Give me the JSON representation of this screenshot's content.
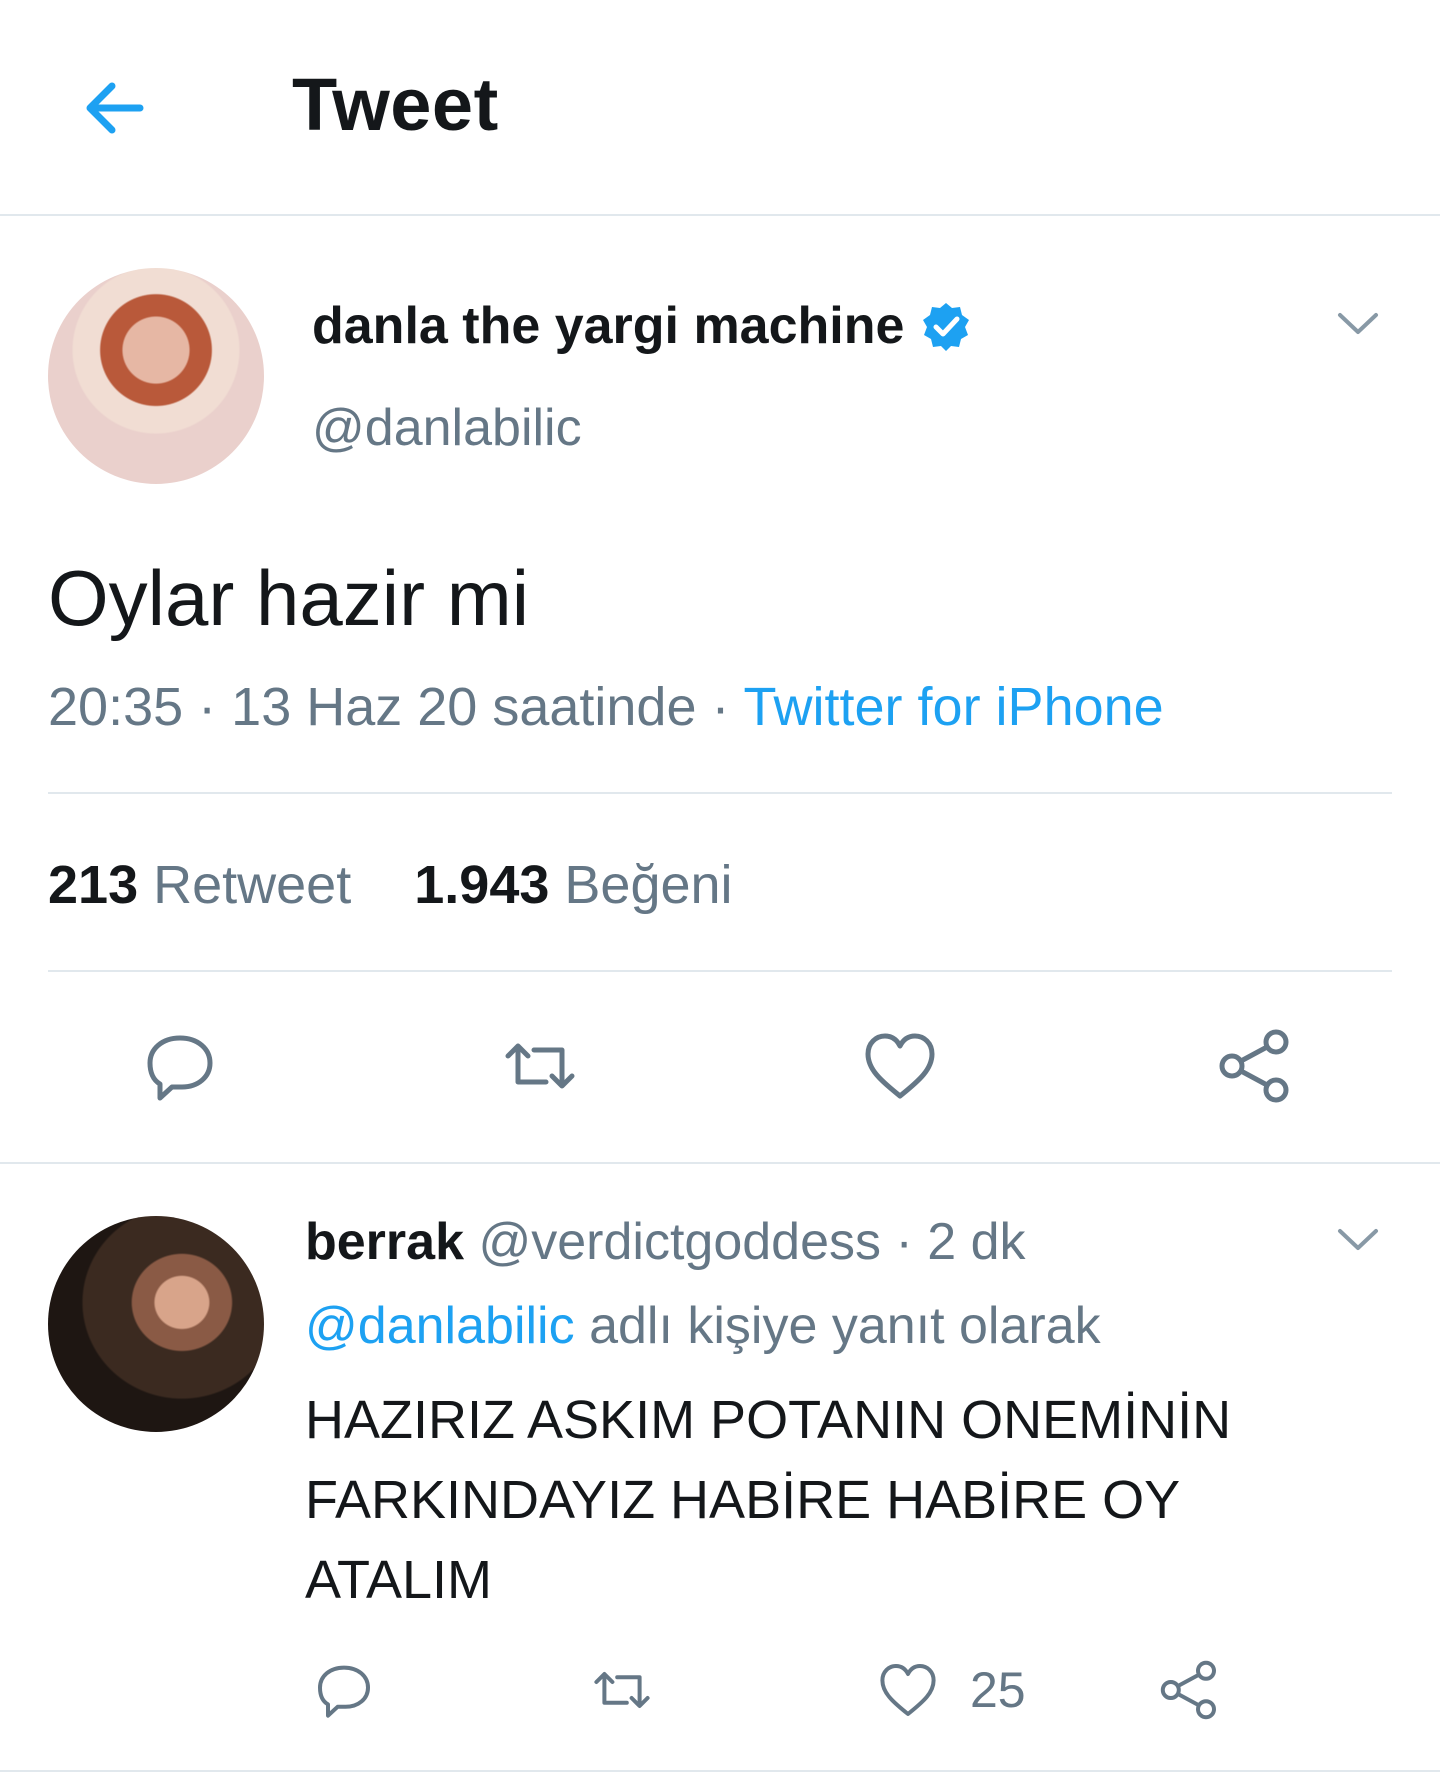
{
  "header": {
    "title": "Tweet",
    "back_icon": "arrow-left-icon",
    "accent": "#1da1f2"
  },
  "tweet": {
    "display_name": "danla the yargi machine",
    "verified": true,
    "handle": "@danlabilic",
    "text": "Oylar hazir mi",
    "time": "20:35",
    "dot1": "·",
    "date": "13 Haz 20 saatinde",
    "dot2": "·",
    "source": "Twitter for iPhone",
    "retweet_count": "213",
    "retweet_label": "Retweet",
    "like_count": "1.943",
    "like_label": "Beğeni",
    "actions": [
      "reply-icon",
      "retweet-icon",
      "like-icon",
      "share-icon"
    ]
  },
  "reply": {
    "display_name": "berrak",
    "handle": "@verdictgoddess",
    "dot": "·",
    "age": "2 dk",
    "replying_to": "@danlabilic",
    "replying_suffix": "adlı kişiye yanıt olarak",
    "text": "HAZIRIZ ASKIM POTANIN ONEMİNİN FARKINDAYIZ HABİRE HABİRE OY ATALIM",
    "like_count": "25"
  },
  "colors": {
    "text": "#14171a",
    "secondary": "#657786",
    "divider": "#e1e8ed",
    "accent": "#1da1f2"
  }
}
